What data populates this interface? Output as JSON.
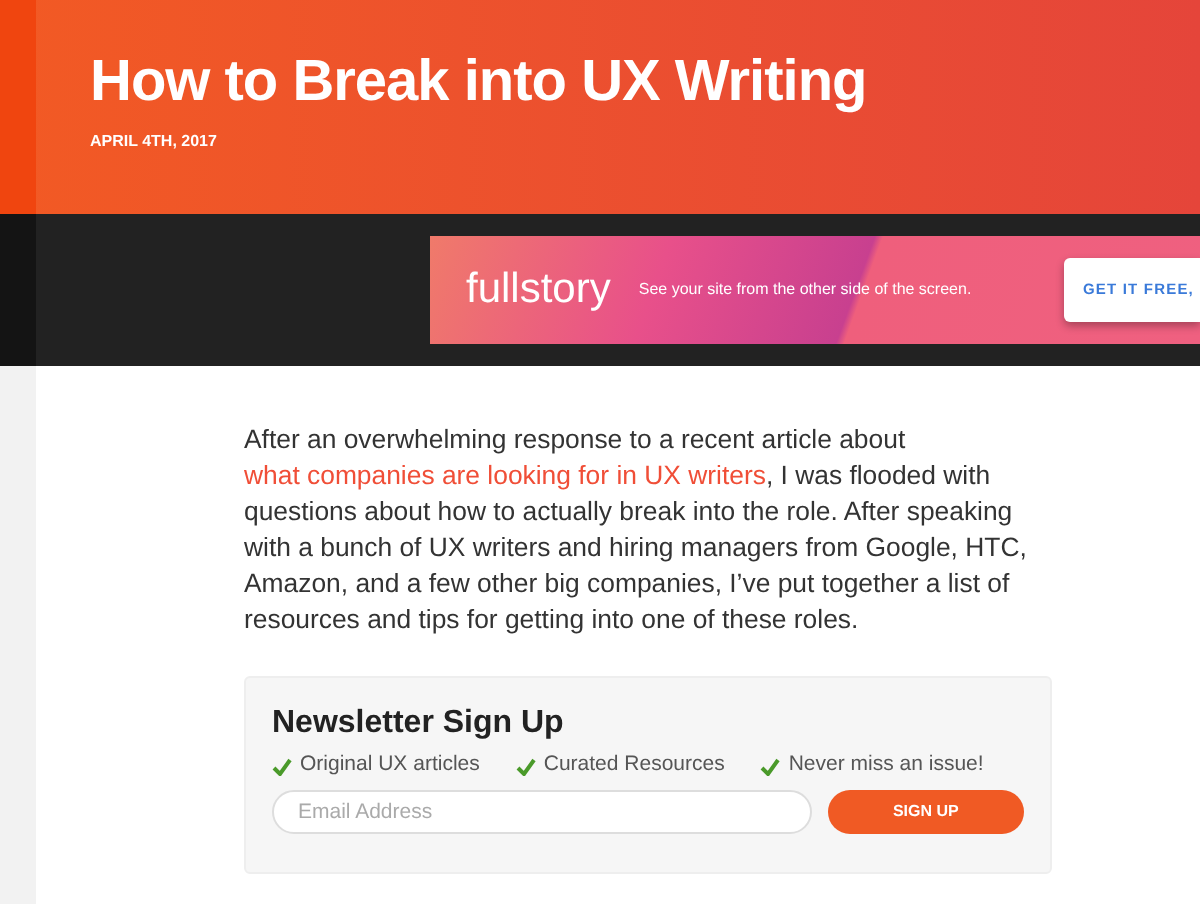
{
  "header": {
    "title": "How to Break into UX Writing",
    "date": "APRIL 4TH, 2017"
  },
  "ad": {
    "logo": "fullstory",
    "tagline": "See your site from the other side of the screen.",
    "button": "GET IT FREE,"
  },
  "intro": {
    "before": "After an overwhelming response to a recent article about ",
    "link": "what companies are looking for in UX writers",
    "after": ", I was flooded with questions about how to actually break into the role. After speaking with a bunch of UX writers and hiring managers from Google, HTC, Amazon, and a few other big companies, I’ve put together a list of resources and tips for getting into one of these roles."
  },
  "newsletter": {
    "title": "Newsletter Sign Up",
    "benefits": [
      "Original UX articles",
      "Curated Resources",
      "Never miss an issue!"
    ],
    "email": {
      "placeholder": "Email Address"
    },
    "button": "SIGN UP"
  }
}
